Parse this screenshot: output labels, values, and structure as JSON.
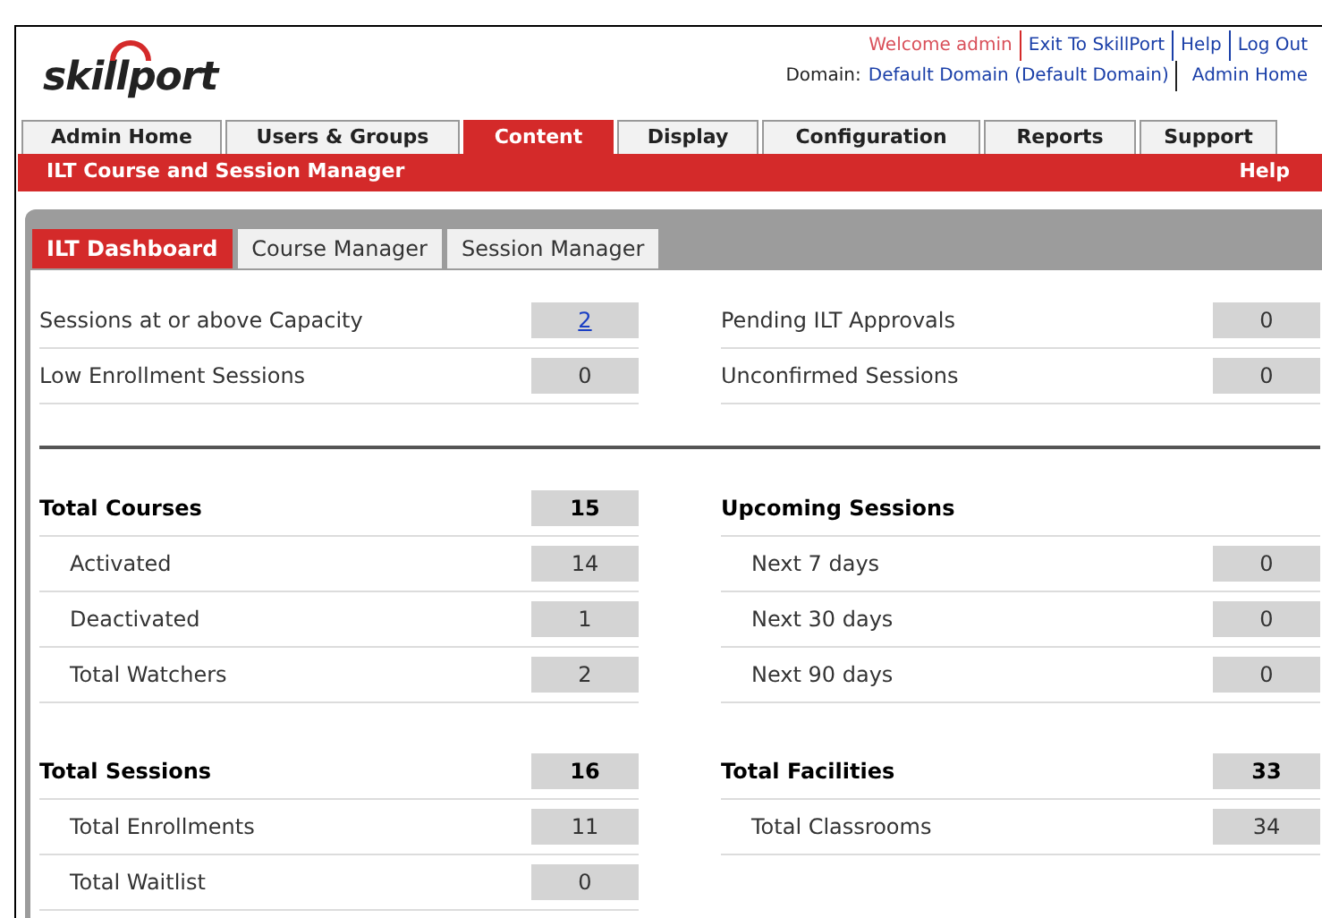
{
  "header": {
    "logo": "skillport",
    "top_links": [
      {
        "text": "Welcome admin",
        "kind": "greeting"
      },
      {
        "text": "Exit To SkillPort",
        "kind": "link"
      },
      {
        "text": "Help",
        "kind": "link"
      },
      {
        "text": "Log Out",
        "kind": "link"
      }
    ],
    "domain_label": "Domain:",
    "domain_value": "Default Domain (Default Domain)",
    "admin_home": "Admin Home"
  },
  "nav_tabs": [
    {
      "label": "Admin Home",
      "selected": false
    },
    {
      "label": "Users & Groups",
      "selected": false
    },
    {
      "label": "Content",
      "selected": true
    },
    {
      "label": "Display",
      "selected": false
    },
    {
      "label": "Configuration",
      "selected": false
    },
    {
      "label": "Reports",
      "selected": false
    },
    {
      "label": "Support",
      "selected": false
    }
  ],
  "section_bar": {
    "title": "ILT Course and Session Manager",
    "help": "Help"
  },
  "sub_tabs": [
    {
      "label": "ILT Dashboard",
      "selected": true
    },
    {
      "label": "Course Manager",
      "selected": false
    },
    {
      "label": "Session Manager",
      "selected": false
    }
  ],
  "alerts": {
    "left": [
      {
        "label": "Sessions at or above Capacity",
        "value": "2",
        "link": true
      },
      {
        "label": "Low Enrollment Sessions",
        "value": "0",
        "link": false
      }
    ],
    "right": [
      {
        "label": "Pending ILT Approvals",
        "value": "0",
        "link": false
      },
      {
        "label": "Unconfirmed Sessions",
        "value": "0",
        "link": false
      }
    ]
  },
  "groups": {
    "left": [
      {
        "title": "Total Courses",
        "value": "15",
        "items": [
          {
            "label": "Activated",
            "value": "14"
          },
          {
            "label": "Deactivated",
            "value": "1"
          },
          {
            "label": "Total Watchers",
            "value": "2"
          }
        ]
      },
      {
        "title": "Total Sessions",
        "value": "16",
        "items": [
          {
            "label": "Total Enrollments",
            "value": "11"
          },
          {
            "label": "Total Waitlist",
            "value": "0"
          }
        ]
      }
    ],
    "right": [
      {
        "title": "Upcoming Sessions",
        "items": [
          {
            "label": "Next 7 days",
            "value": "0"
          },
          {
            "label": "Next 30 days",
            "value": "0"
          },
          {
            "label": "Next 90 days",
            "value": "0"
          }
        ]
      },
      {
        "title": "Total Facilities",
        "value": "33",
        "items": [
          {
            "label": "Total Classrooms",
            "value": "34"
          }
        ]
      }
    ]
  }
}
